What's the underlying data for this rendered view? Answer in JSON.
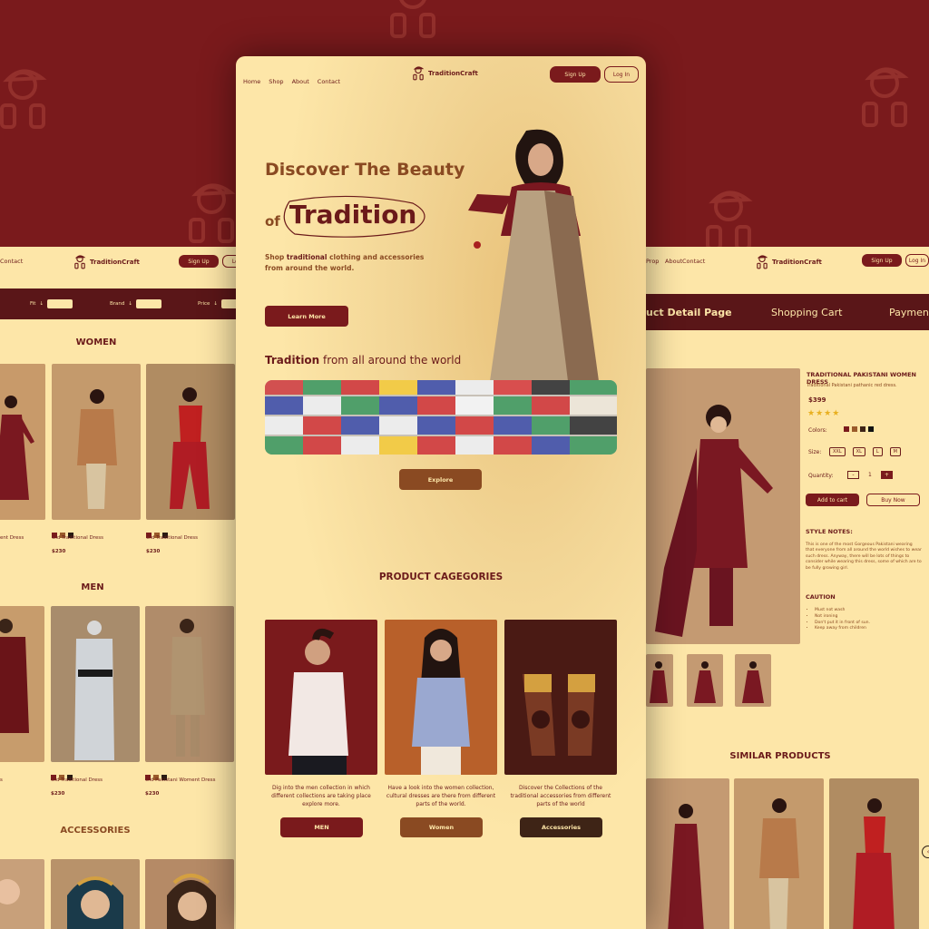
{
  "brand": {
    "name": "TraditionCraft"
  },
  "center": {
    "nav": [
      "Home",
      "Shop",
      "About",
      "Contact"
    ],
    "signup": "Sign Up",
    "login": "Log In",
    "hero_line1": "Discover The Beauty",
    "hero_of": "of",
    "hero_tradition": "Tradition",
    "hero_sub_pre": "Shop ",
    "hero_sub_bold": "traditional",
    "hero_sub_post": " clothing and accessories from around the world.",
    "learn_more": "Learn More",
    "world_bold": "Tradition",
    "world_rest": " from all around the world",
    "explore": "Explore",
    "categories_title": "PRODUCT CAGEGORIES",
    "categories": [
      {
        "desc": "Dig into the men collection in which different collections are taking place explore more.",
        "button": "MEN",
        "color": "#7a1a1c"
      },
      {
        "desc": "Have a look into the women collection, cultural dresses are there from different parts of the world.",
        "button": "Women",
        "color": "#8a4a22"
      },
      {
        "desc": "Discover the Collections of the traditional accessories from different parts of the world",
        "button": "Accessories",
        "color": "#3e2416"
      }
    ]
  },
  "left": {
    "nav": [
      "Contact"
    ],
    "signup": "Sign Up",
    "login": "Log In",
    "filters": [
      "Fit",
      "Brand",
      "Price"
    ],
    "women_title": "WOMEN",
    "men_title": "MEN",
    "accessories_title": "ACCESSORIES",
    "women_products": [
      {
        "title": "ent Dress",
        "price": ""
      },
      {
        "title": "Old Traditional Dress",
        "price": "$230"
      },
      {
        "title": "Old Traditional Dress",
        "price": "$230"
      }
    ],
    "men_products": [
      {
        "title": "s",
        "price": ""
      },
      {
        "title": "Old Traditional Dress",
        "price": "$230"
      },
      {
        "title": "Old Pakistani Woment Dress",
        "price": "$230"
      }
    ],
    "swatch_colors": [
      "#7a1a1c",
      "#9a5a2a",
      "#2a1a12"
    ]
  },
  "right": {
    "nav": [
      "Prop",
      "About",
      "Contact"
    ],
    "signup": "Sign Up",
    "login": "Log In",
    "tabs": [
      "uct Detail Page",
      "Shopping Cart",
      "Payment"
    ],
    "product_title": "TRADITIONAL PAKISTANI WOMEN DRESS",
    "product_subtitle": "Traditional Pakistani pathanic red dress.",
    "price": "$399",
    "stars": "★★★★",
    "colors_label": "Colors:",
    "color_options": [
      "#7a1a1c",
      "#9a5a2a",
      "#3e2416",
      "#111111"
    ],
    "size_label": "Size:",
    "sizes": [
      "XXL",
      "XL",
      "L",
      "M"
    ],
    "quantity_label": "Quantity:",
    "qty_minus": "-",
    "qty_value": "1",
    "qty_plus": "+",
    "add_to_cart": "Add to cart",
    "buy_now": "Buy Now",
    "style_notes_title": "STYLE NOTES:",
    "style_notes": "This is one of the most Gorgeous Pakistani wearing that everyone from all around the world wishes to wear such dress. Anyway, there will be lots of things to consider while wearing this dress, some of which are to be fully growing girl.",
    "caution_title": "CAUTION",
    "caution_items": [
      "Must not wash",
      "Not ironing",
      "Don't put it in front of sun.",
      "Keep away from children"
    ],
    "similar_title": "SIMILAR PRODUCTS"
  },
  "colors": {
    "maroon": "#7a1a1c",
    "cream": "#fde6a8",
    "dark_bar": "#5a1618",
    "brown": "#8a4a22"
  }
}
